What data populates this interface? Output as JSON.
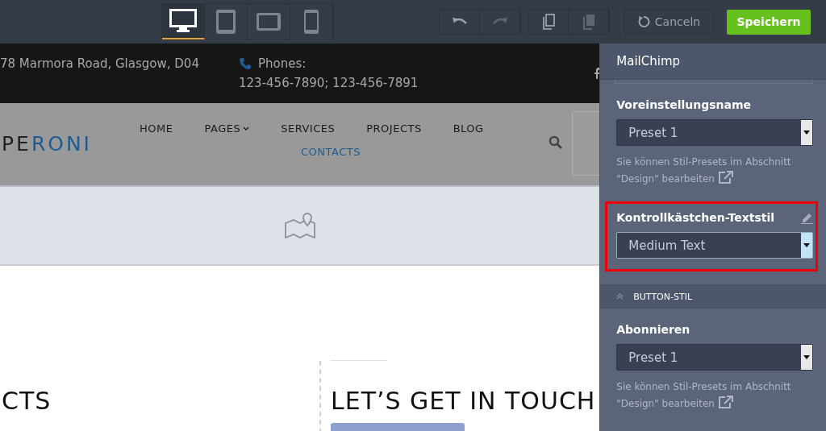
{
  "toolbar": {
    "devices": [
      {
        "kind": "desktop",
        "selected": true
      },
      {
        "kind": "tablet",
        "selected": false
      },
      {
        "kind": "tablet-landscape",
        "selected": false
      },
      {
        "kind": "phone",
        "selected": false
      }
    ],
    "cancel": "Canceln",
    "save": "Speichern"
  },
  "site": {
    "address": "78 Marmora Road, Glasgow, D04",
    "phones_label": "Phones:",
    "phones": "123-456-7890; 123-456-7891",
    "logo": {
      "dark": "PE",
      "accent": "RONI"
    },
    "nav": [
      {
        "label": "HOME",
        "dropdown": false,
        "selected": false
      },
      {
        "label": "PAGES",
        "dropdown": true,
        "selected": false
      },
      {
        "label": "SERVICES",
        "dropdown": false,
        "selected": false
      },
      {
        "label": "PROJECTS",
        "dropdown": false,
        "selected": false
      },
      {
        "label": "BLOG",
        "dropdown": false,
        "selected": false
      },
      {
        "label": "CONTACTS",
        "dropdown": false,
        "selected": true
      }
    ],
    "left_heading": "CTS",
    "right_heading": "LET’S GET IN TOUCH"
  },
  "panel": {
    "title": "MailChimp",
    "items": [
      {
        "kind": "select",
        "label": "Voreinstellungsname",
        "value": "Preset 1",
        "hint": "Sie können Stil-Presets im Abschnitt \"Design\" bearbeiten",
        "highlighted": false,
        "editable": false
      },
      {
        "kind": "select",
        "label": "Kontrollkästchen-Textstil",
        "value": "Medium Text",
        "highlighted": true,
        "editable": true
      },
      {
        "kind": "section",
        "label": "BUTTON-STIL"
      },
      {
        "kind": "select",
        "label": "Abonnieren",
        "value": "Preset 1",
        "hint": "Sie können Stil-Presets im Abschnitt \"Design\" bearbeiten",
        "highlighted": false,
        "editable": false
      }
    ]
  }
}
